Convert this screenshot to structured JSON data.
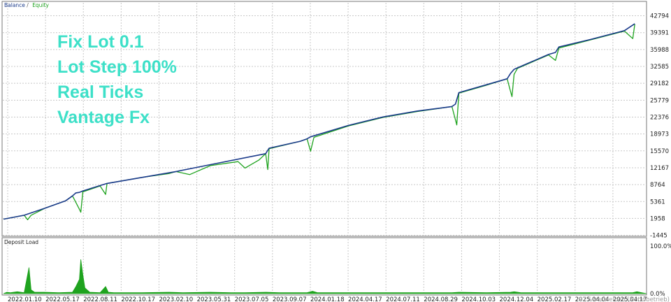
{
  "chart_data": [
    {
      "type": "line",
      "legend": {
        "items": [
          {
            "label": "Balance",
            "color": "#1a3a8a"
          },
          {
            "label": "Equity",
            "color": "#1fa31f"
          }
        ],
        "placement": "top-left"
      },
      "overlay_text": [
        "Fix Lot 0.1",
        "Lot Step 100%",
        "Real Ticks",
        "Vantage Fx"
      ],
      "overlay_color": "#3de0c8",
      "ylim": [
        -1645,
        44000
      ],
      "y_ticks": [
        "42794",
        "39391",
        "35988",
        "32585",
        "29182",
        "25779",
        "22376",
        "18973",
        "15570",
        "12167",
        "8764",
        "5361",
        "1958",
        "-1445"
      ],
      "y_tick_values": [
        42794,
        39391,
        35988,
        32585,
        29182,
        25779,
        22376,
        18973,
        15570,
        12167,
        8764,
        5361,
        1958,
        -1445
      ],
      "grid": true,
      "series": [
        {
          "name": "Balance",
          "color": "#1a3a8a",
          "x": [
            0,
            30,
            60,
            90,
            100,
            105,
            110,
            115,
            150,
            200,
            250,
            300,
            380,
            385,
            430,
            440,
            445,
            500,
            550,
            600,
            650,
            655,
            660,
            700,
            730,
            735,
            740,
            745,
            790,
            800,
            805,
            850,
            900,
            915
          ],
          "values": [
            1800,
            2600,
            4000,
            5500,
            6500,
            7100,
            7200,
            7500,
            9000,
            10200,
            11400,
            12800,
            15000,
            16100,
            17500,
            18000,
            18400,
            20700,
            22400,
            23600,
            24500,
            25000,
            27300,
            28900,
            30100,
            31200,
            32000,
            32300,
            35000,
            35400,
            36500,
            38000,
            39800,
            41200
          ]
        },
        {
          "name": "Equity",
          "color": "#1fa31f",
          "x": [
            0,
            30,
            35,
            40,
            60,
            90,
            100,
            110,
            112,
            115,
            140,
            148,
            150,
            200,
            240,
            250,
            270,
            300,
            340,
            350,
            370,
            380,
            383,
            385,
            430,
            440,
            445,
            450,
            500,
            550,
            600,
            650,
            657,
            660,
            700,
            730,
            735,
            737,
            740,
            745,
            790,
            800,
            805,
            850,
            900,
            912,
            915
          ],
          "values": [
            1800,
            2600,
            1700,
            2600,
            4000,
            5500,
            6500,
            3800,
            3200,
            7300,
            8500,
            6800,
            9000,
            10200,
            11000,
            11400,
            10800,
            12600,
            13400,
            12100,
            13700,
            15000,
            11800,
            16000,
            17500,
            18000,
            15500,
            18300,
            20600,
            22300,
            23500,
            24500,
            20800,
            27200,
            28800,
            30100,
            27500,
            26500,
            31000,
            32200,
            34900,
            33800,
            36300,
            37900,
            39700,
            38200,
            41100
          ]
        }
      ],
      "x_categories": [
        "2022.01.10",
        "2022.05.17",
        "2022.08.11",
        "2022.10.17",
        "2023.02.10",
        "2023.05.31",
        "2023.07.05",
        "2023.09.07",
        "2024.01.18",
        "2024.04.17",
        "2024.07.11",
        "2024.08.29",
        "2024.10.03",
        "2024.12.04",
        "2025.02.17",
        "2025.04.04",
        "2025.04.17"
      ]
    },
    {
      "type": "area",
      "title": "Deposit Load",
      "ylim": [
        0,
        100
      ],
      "y_ticks": [
        "100.0%",
        "0.0%"
      ],
      "color": "#1fa31f",
      "x": [
        0,
        5,
        10,
        20,
        30,
        35,
        37,
        40,
        45,
        60,
        80,
        100,
        105,
        110,
        112,
        115,
        118,
        125,
        140,
        148,
        152,
        160,
        200,
        240,
        260,
        300,
        330,
        350,
        380,
        400,
        440,
        448,
        455,
        500,
        550,
        600,
        650,
        660,
        700,
        735,
        740,
        750,
        800,
        850,
        900,
        912,
        918,
        932
      ],
      "values": [
        0,
        3,
        2,
        4,
        2,
        40,
        55,
        8,
        3,
        3,
        2,
        3,
        15,
        30,
        72,
        40,
        12,
        3,
        2,
        15,
        3,
        2,
        2,
        3,
        2,
        3,
        2,
        2,
        3,
        2,
        2,
        5,
        2,
        2,
        2,
        2,
        2,
        3,
        2,
        3,
        4,
        2,
        2,
        2,
        2,
        2,
        4,
        0
      ]
    }
  ],
  "footer_note": "97% verbleiben (Nettobetrieb) ||"
}
